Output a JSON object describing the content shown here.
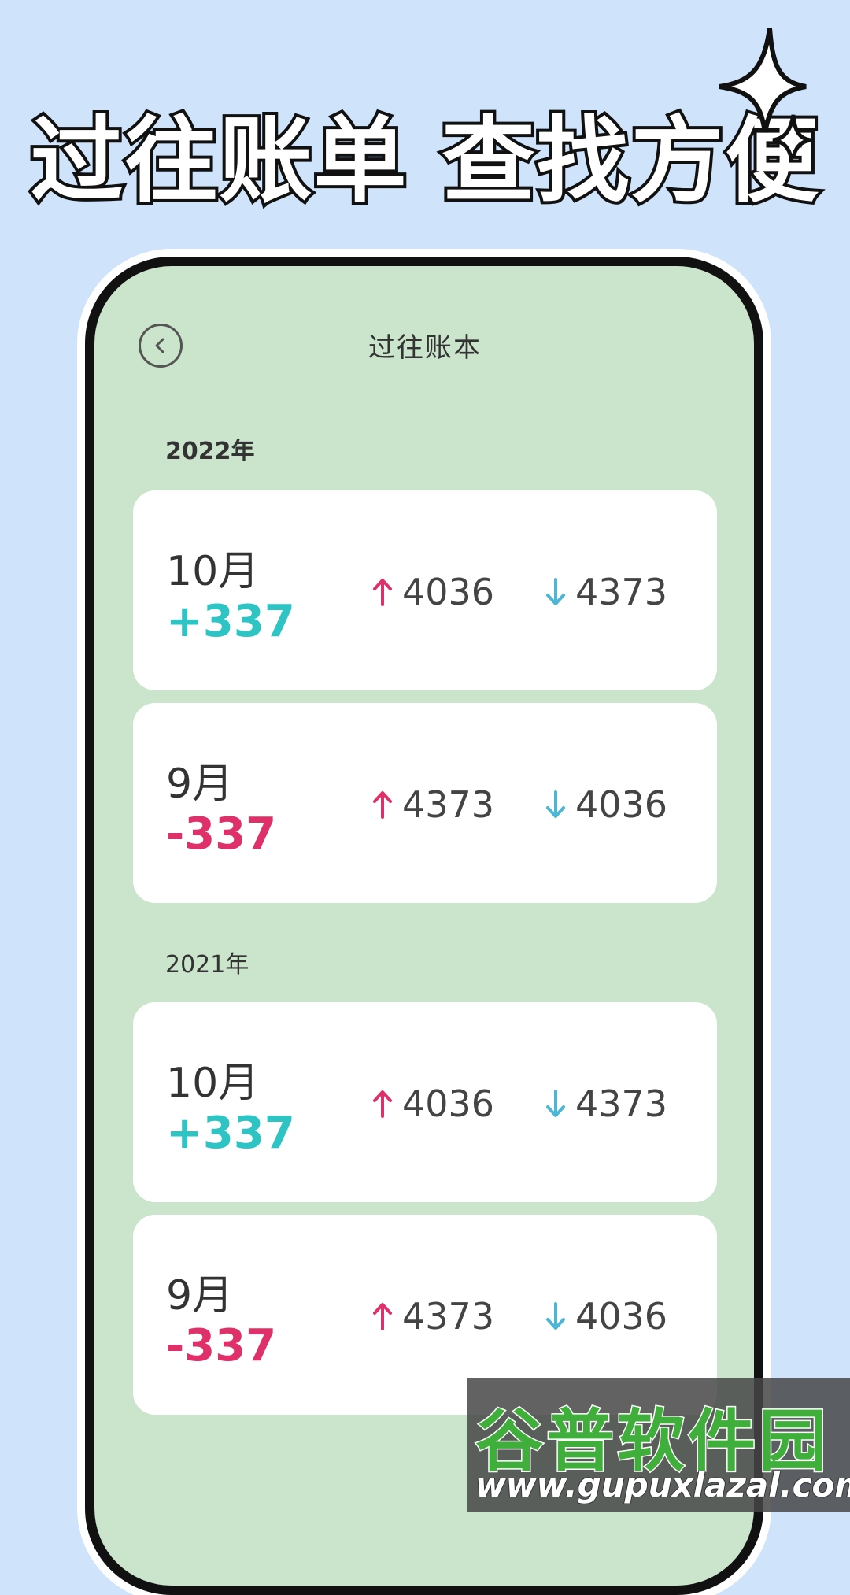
{
  "headline": "过往账单 查找方便",
  "nav": {
    "title": "过往账本"
  },
  "groups": [
    {
      "year": "2022年",
      "cards": [
        {
          "month": "10月",
          "delta": "+337",
          "income": "4036",
          "expense": "4373"
        },
        {
          "month": "9月",
          "delta": "-337",
          "income": "4373",
          "expense": "4036"
        }
      ]
    },
    {
      "year": "2021年",
      "cards": [
        {
          "month": "10月",
          "delta": "+337",
          "income": "4036",
          "expense": "4373"
        },
        {
          "month": "9月",
          "delta": "-337",
          "income": "4373",
          "expense": "4036"
        }
      ]
    }
  ],
  "watermark": {
    "name": "谷普软件园",
    "url": "www.gupuxlazal.com"
  },
  "icons": {
    "back": "chevron-left-icon",
    "income": "arrow-up-icon",
    "expense": "arrow-down-icon",
    "decor": "sparkle-icon"
  },
  "colors": {
    "positive": "#2ec4c4",
    "negative": "#e0306a",
    "income_arrow": "#e0306a",
    "expense_arrow": "#4bb6d6"
  }
}
